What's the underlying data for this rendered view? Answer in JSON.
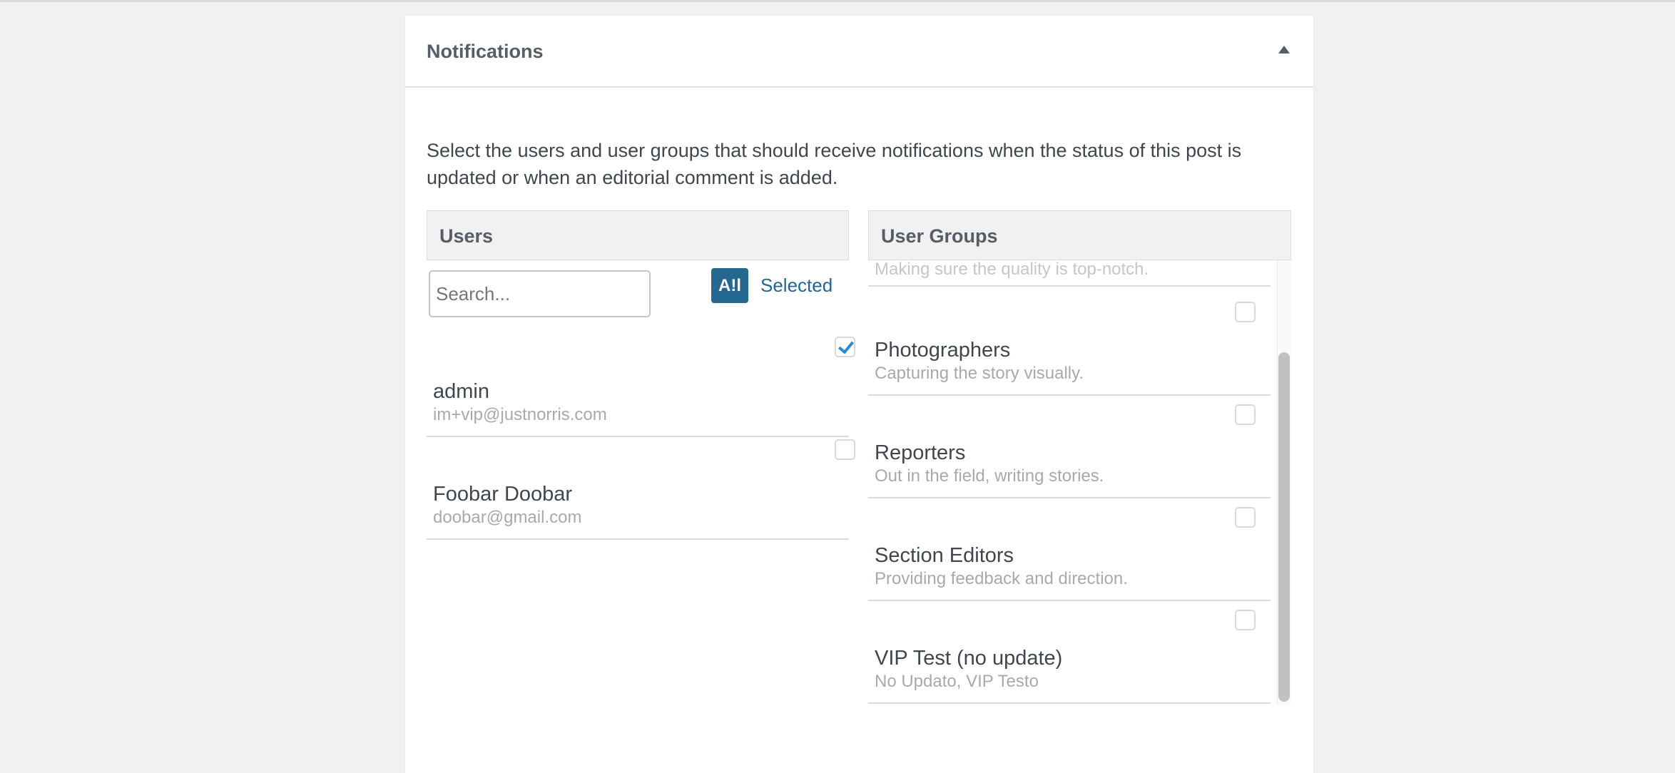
{
  "panel": {
    "title": "Notifications",
    "intro": "Select the users and user groups that should receive notifications when the status of this post is updated or when an editorial comment is added."
  },
  "users": {
    "header": "Users",
    "search_placeholder": "Search...",
    "all_label": "A!l",
    "selected_label": "Selected",
    "items": [
      {
        "name": "admin",
        "email": "im+vip@justnorris.com",
        "checked": true
      },
      {
        "name": "Foobar Doobar",
        "email": "doobar@gmail.com",
        "checked": false
      }
    ]
  },
  "groups": {
    "header": "User Groups",
    "partial_text": "Making sure the quality is top-notch.",
    "items": [
      {
        "name": "Photographers",
        "description": "Capturing the story visually.",
        "checked": false
      },
      {
        "name": "Reporters",
        "description": "Out in the field, writing stories.",
        "checked": false
      },
      {
        "name": "Section Editors",
        "description": "Providing feedback and direction.",
        "checked": false
      },
      {
        "name": "VIP Test (no update)",
        "description": "No Updato, VIP Testo",
        "checked": false
      }
    ]
  },
  "colors": {
    "accent": "#24688f",
    "link": "#1d6795",
    "checkmark": "#2a8ad0"
  }
}
